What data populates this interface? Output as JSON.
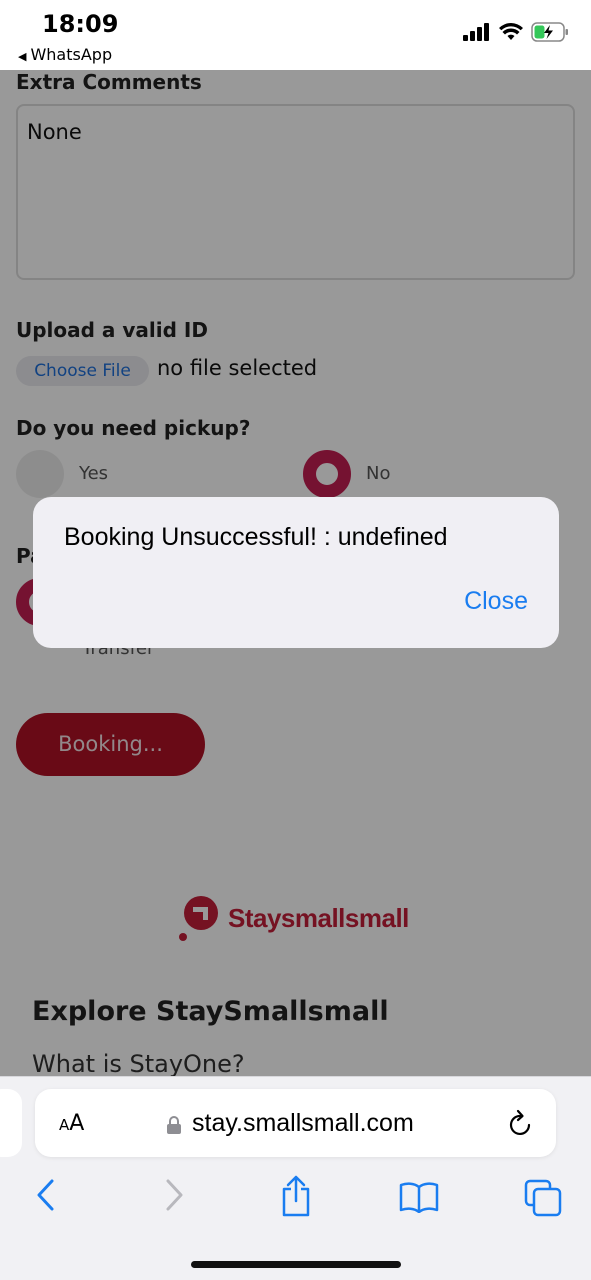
{
  "status_bar": {
    "time": "18:09",
    "back_app": "WhatsApp"
  },
  "form": {
    "extra_comments_label": "Extra Comments",
    "extra_comments_value": "None",
    "upload_label": "Upload a valid ID",
    "choose_file_label": "Choose File",
    "file_status": "no file selected",
    "pickup_label": "Do you need pickup?",
    "pickup_options": [
      {
        "label": "Yes",
        "selected": false
      },
      {
        "label": "No",
        "selected": true
      }
    ],
    "payment_label_partial": "Pa",
    "payment_option_partial": "Transfer",
    "booking_button": "Booking..."
  },
  "footer": {
    "logo_text": "Staysmallsmall",
    "explore_heading": "Explore StaySmallsmall",
    "explore_link": "What is StayOne?"
  },
  "alert": {
    "message": "Booking Unsuccessful! : undefined",
    "close_label": "Close"
  },
  "browser": {
    "aa_label": "AA",
    "url": "stay.smallsmall.com"
  },
  "colors": {
    "brand": "#c41e3a",
    "radio_selected": "#c41e52",
    "link_blue": "#1a7df0"
  }
}
